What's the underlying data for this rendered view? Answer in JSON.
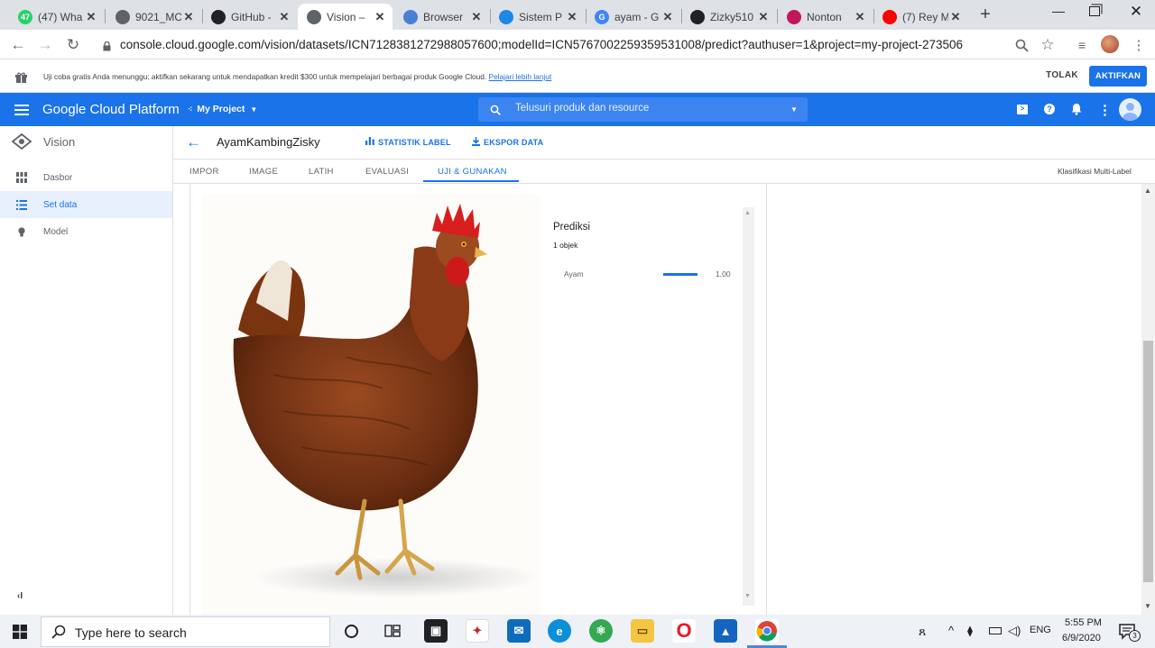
{
  "browser": {
    "tabs": [
      {
        "title": "(47) Wha",
        "favicon": "whatsapp-icon",
        "color": "#25d366",
        "badge": "47"
      },
      {
        "title": "9021_MC",
        "favicon": "globe-icon",
        "color": "#5f6368",
        "badge": ""
      },
      {
        "title": "GitHub -",
        "favicon": "github-icon",
        "color": "#202124",
        "badge": ""
      },
      {
        "title": "Vision – ",
        "favicon": "vision-icon",
        "color": "#5f6368",
        "badge": ""
      },
      {
        "title": "Browser ",
        "favicon": "browser-icon",
        "color": "#4a7fd4",
        "badge": ""
      },
      {
        "title": "Sistem P",
        "favicon": "classroom-icon",
        "color": "#1e88e5",
        "badge": ""
      },
      {
        "title": "ayam - G",
        "favicon": "google-icon",
        "color": "#4285f4",
        "badge": "G"
      },
      {
        "title": "Zizky510",
        "favicon": "github-icon",
        "color": "#202124",
        "badge": ""
      },
      {
        "title": "Nonton ",
        "favicon": "movie-icon",
        "color": "#c2185b",
        "badge": ""
      },
      {
        "title": "(7) Rey M",
        "favicon": "youtube-icon",
        "color": "#ff0000",
        "badge": ""
      }
    ],
    "url": "console.cloud.google.com/vision/datasets/ICN7128381272988057600;modelId=ICN5767002259359531008/predict?authuser=1&project=my-project-273506"
  },
  "trial_banner": {
    "text": "Uji coba gratis Anda menunggu: aktifkan sekarang untuk mendapatkan kredit $300 untuk mempelajari berbagai produk Google Cloud.",
    "link": "Pelajari lebih lanjut",
    "dismiss": "TOLAK",
    "activate": "AKTIFKAN"
  },
  "appbar": {
    "title": "Google Cloud Platform",
    "project": "My Project",
    "search_placeholder": "Telusuri produk dan resource"
  },
  "sidebar": {
    "product": "Vision",
    "items": [
      {
        "label": "Dasbor"
      },
      {
        "label": "Set data"
      },
      {
        "label": "Model"
      }
    ],
    "collapse": "‹I"
  },
  "dataset": {
    "name": "AyamKambingZisky",
    "stats_label": "STATISTIK LABEL",
    "export_label": "EKSPOR DATA",
    "type": "Klasifikasi Multi-Label"
  },
  "tabs": [
    "IMPOR",
    "IMAGE",
    "LATIH",
    "EVALUASI",
    "UJI & GUNAKAN"
  ],
  "prediction": {
    "title": "Prediksi",
    "count": "1 objek",
    "results": [
      {
        "label": "Ayam",
        "score": "1,00",
        "fraction": 1.0
      }
    ]
  },
  "taskbar": {
    "search_placeholder": "Type here to search",
    "lang": "ENG",
    "time": "5:55 PM",
    "date": "6/9/2020",
    "notifications": "3"
  },
  "colors": {
    "accent": "#1a73e8",
    "tabbar": "#dee1e6"
  }
}
